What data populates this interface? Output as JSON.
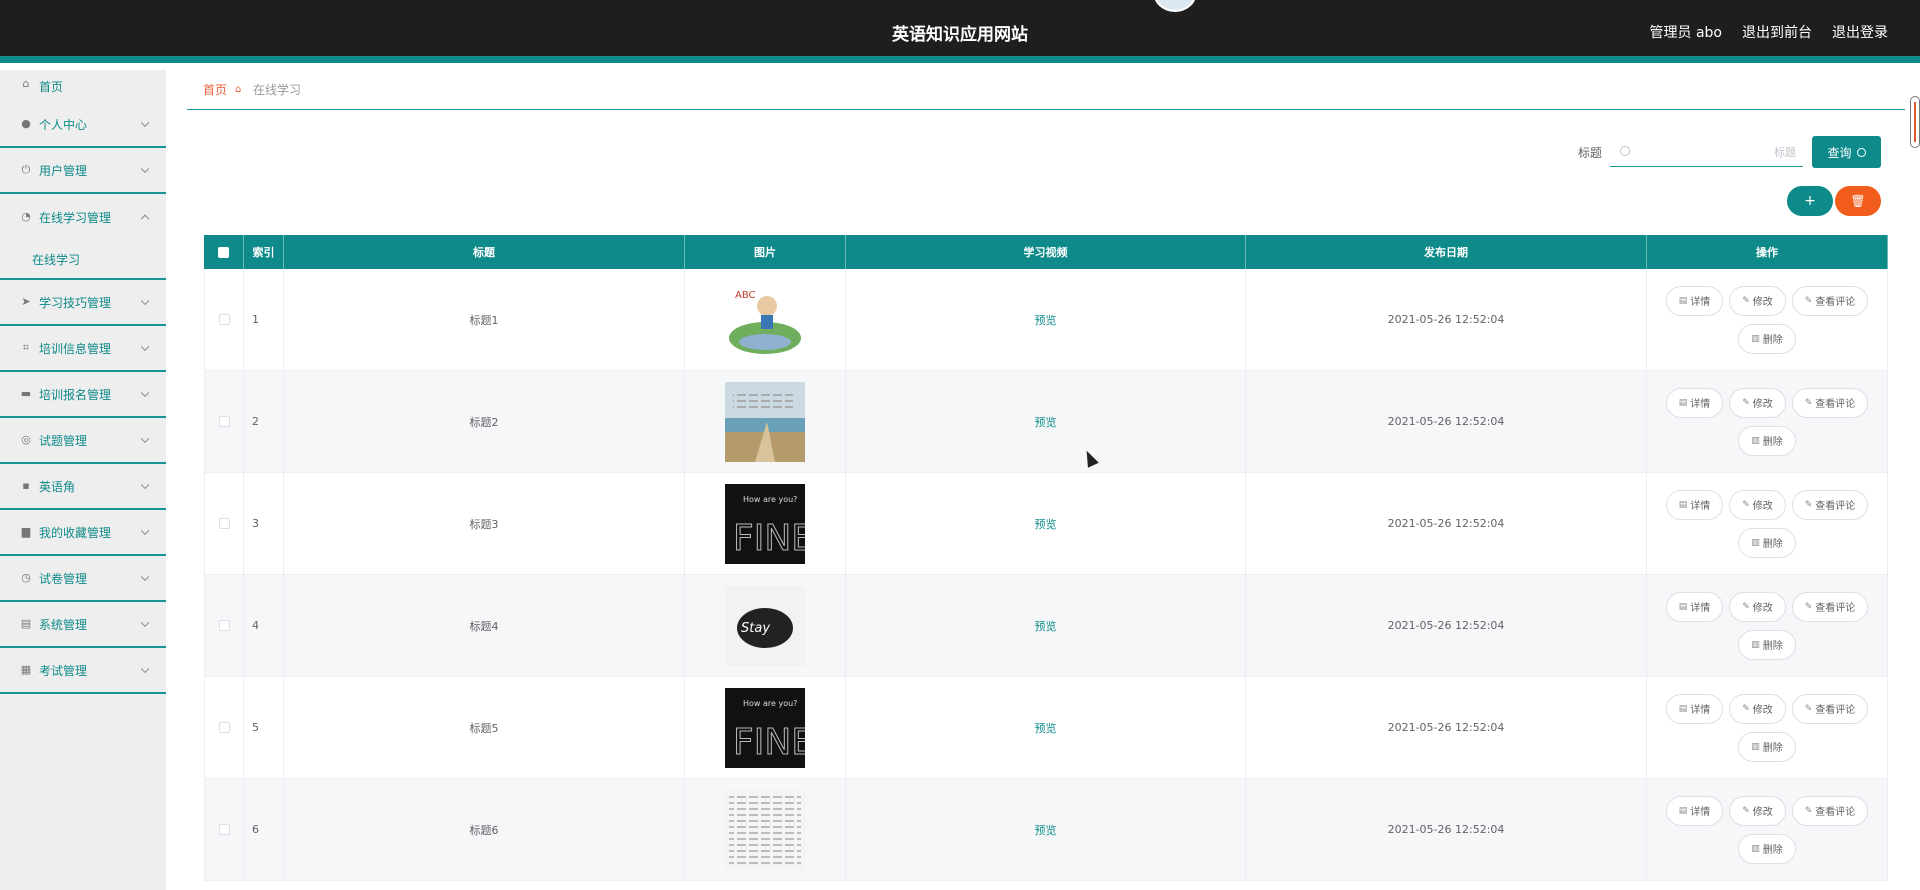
{
  "header": {
    "title": "英语知识应用网站",
    "admin": "管理员 abo",
    "to_front": "退出到前台",
    "logout": "退出登录"
  },
  "sidebar": {
    "items": [
      {
        "label": "首页",
        "icon": "home-icon"
      },
      {
        "label": "个人中心",
        "icon": "user-icon"
      },
      {
        "label": "用户管理",
        "icon": "power-icon"
      },
      {
        "label": "在线学习管理",
        "icon": "dashboard-icon",
        "expanded": true,
        "sub": [
          "在线学习"
        ]
      },
      {
        "label": "学习技巧管理",
        "icon": "send-icon"
      },
      {
        "label": "培训信息管理",
        "icon": "crop-icon"
      },
      {
        "label": "培训报名管理",
        "icon": "message-icon"
      },
      {
        "label": "试题管理",
        "icon": "target-icon"
      },
      {
        "label": "英语角",
        "icon": "briefcase-icon"
      },
      {
        "label": "我的收藏管理",
        "icon": "folder-icon"
      },
      {
        "label": "试卷管理",
        "icon": "clock-icon"
      },
      {
        "label": "系统管理",
        "icon": "clipboard-icon"
      },
      {
        "label": "考试管理",
        "icon": "calendar-icon"
      }
    ]
  },
  "breadcrumb": {
    "home": "首页",
    "current": "在线学习"
  },
  "search": {
    "label": "标题",
    "placeholder": "标题",
    "button": "查询"
  },
  "actions": {
    "add": "+",
    "delete": "🗑"
  },
  "table": {
    "headers": [
      "索引",
      "标题",
      "图片",
      "学习视频",
      "发布日期",
      "操作"
    ],
    "rows": [
      {
        "index": "1",
        "title": "标题1",
        "video": "预览",
        "date": "2021-05-26 12:52:04"
      },
      {
        "index": "2",
        "title": "标题2",
        "video": "预览",
        "date": "2021-05-26 12:52:04"
      },
      {
        "index": "3",
        "title": "标题3",
        "video": "预览",
        "date": "2021-05-26 12:52:04"
      },
      {
        "index": "4",
        "title": "标题4",
        "video": "预览",
        "date": "2021-05-26 12:52:04"
      },
      {
        "index": "5",
        "title": "标题5",
        "video": "预览",
        "date": "2021-05-26 12:52:04"
      },
      {
        "index": "6",
        "title": "标题6",
        "video": "预览",
        "date": "2021-05-26 12:52:04"
      }
    ],
    "ops": {
      "detail": "详情",
      "edit": "修改",
      "comments": "查看评论",
      "delete": "删除"
    }
  },
  "colors": {
    "accent": "#0e8a8a",
    "danger": "#f25d1c",
    "header_bg": "#1e1e1e"
  }
}
